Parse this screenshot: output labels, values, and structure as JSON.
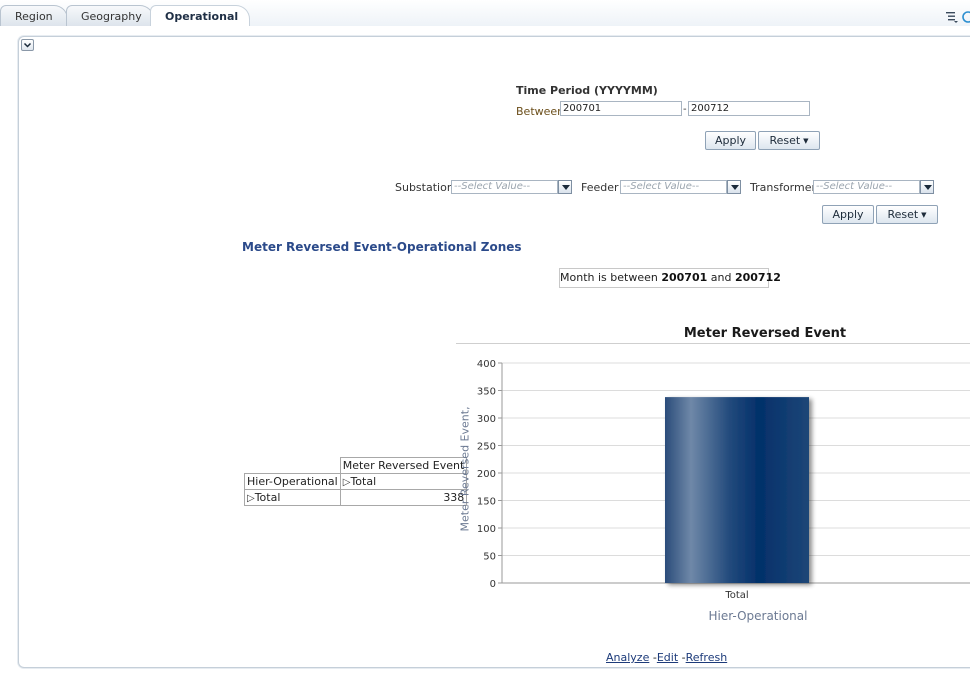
{
  "tabs": [
    {
      "label": "Region",
      "active": false
    },
    {
      "label": "Geography",
      "active": false
    },
    {
      "label": "Operational",
      "active": true
    }
  ],
  "time_filter": {
    "title": "Time Period (YYYYMM)",
    "between_label": "Between",
    "from_value": "200701",
    "separator": "-",
    "to_value": "200712",
    "apply_label": "Apply",
    "reset_label": "Reset"
  },
  "hier_filter": {
    "substation_label": "Substation",
    "substation_value": "--Select Value--",
    "feeder_label": "Feeder",
    "feeder_value": "--Select Value--",
    "transformer_label": "Transformer",
    "transformer_value": "--Select Value--",
    "apply_label": "Apply",
    "reset_label": "Reset"
  },
  "report": {
    "title": "Meter Reversed Event-Operational Zones",
    "filter_prefix": "Month is between",
    "filter_from": "200701",
    "filter_and": "and",
    "filter_to": "200712"
  },
  "pivot": {
    "col_header": "Meter Reversed Event",
    "row_header": "Hier-Operational",
    "col_total": "Total",
    "row_total": "Total",
    "value": "338"
  },
  "chart_data": {
    "type": "bar",
    "title": "Meter Reversed Event",
    "categories": [
      "Total"
    ],
    "values": [
      338
    ],
    "xlabel": "Hier-Operational",
    "ylabel": "Meter Reversed Event,",
    "ylim": [
      0,
      400
    ],
    "yticks": [
      0,
      50,
      100,
      150,
      200,
      250,
      300,
      350,
      400
    ],
    "grid": true,
    "bar_color": "#0b3a73"
  },
  "footer_links": {
    "analyze": "Analyze",
    "edit": "Edit",
    "refresh": "Refresh",
    "sep": "-"
  }
}
